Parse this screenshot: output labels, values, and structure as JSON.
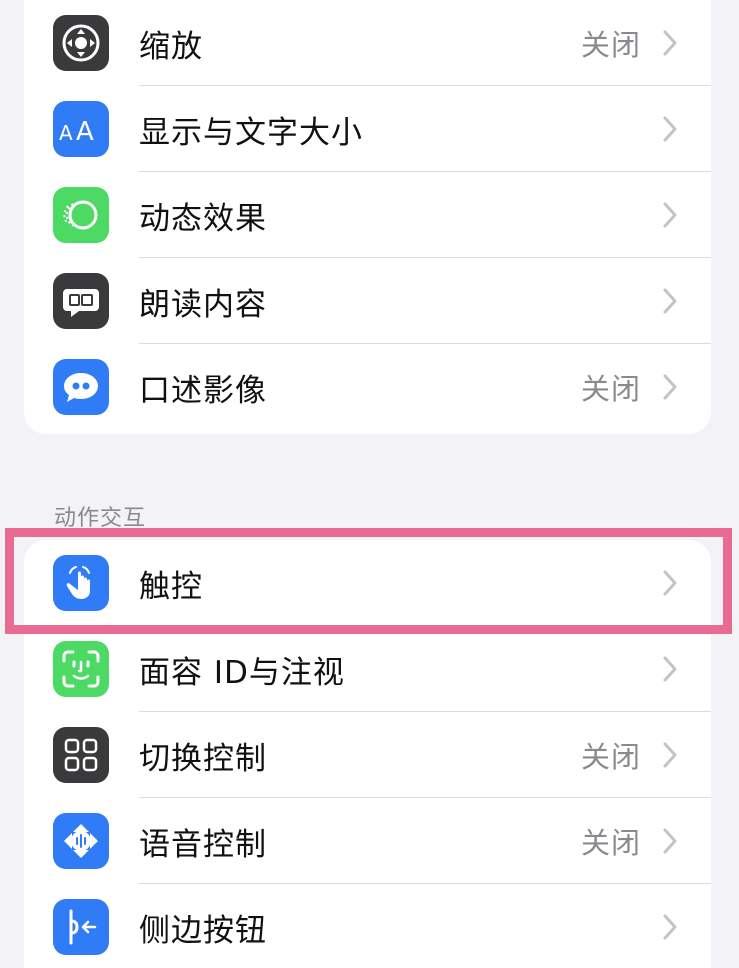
{
  "colors": {
    "background": "#f2f2f7",
    "card": "#ffffff",
    "highlight_border": "#e96a92",
    "secondary_text": "#8a8a8e",
    "icon_blue": "#2f7cf6",
    "icon_green": "#4cd964",
    "icon_dark": "#3a3a3c"
  },
  "vision_group": {
    "items": [
      {
        "label": "缩放",
        "value": "关闭",
        "icon": "zoom-icon"
      },
      {
        "label": "显示与文字大小",
        "value": "",
        "icon": "text-size-icon"
      },
      {
        "label": "动态效果",
        "value": "",
        "icon": "motion-icon"
      },
      {
        "label": "朗读内容",
        "value": "",
        "icon": "spoken-content-icon"
      },
      {
        "label": "口述影像",
        "value": "关闭",
        "icon": "audio-description-icon"
      }
    ]
  },
  "physical_group": {
    "header": "动作交互",
    "items": [
      {
        "label": "触控",
        "value": "",
        "icon": "touch-icon",
        "highlighted": true
      },
      {
        "label": "面容 ID与注视",
        "value": "",
        "icon": "face-id-icon"
      },
      {
        "label": "切换控制",
        "value": "关闭",
        "icon": "switch-control-icon"
      },
      {
        "label": "语音控制",
        "value": "关闭",
        "icon": "voice-control-icon"
      },
      {
        "label": "侧边按钮",
        "value": "",
        "icon": "side-button-icon"
      }
    ]
  }
}
